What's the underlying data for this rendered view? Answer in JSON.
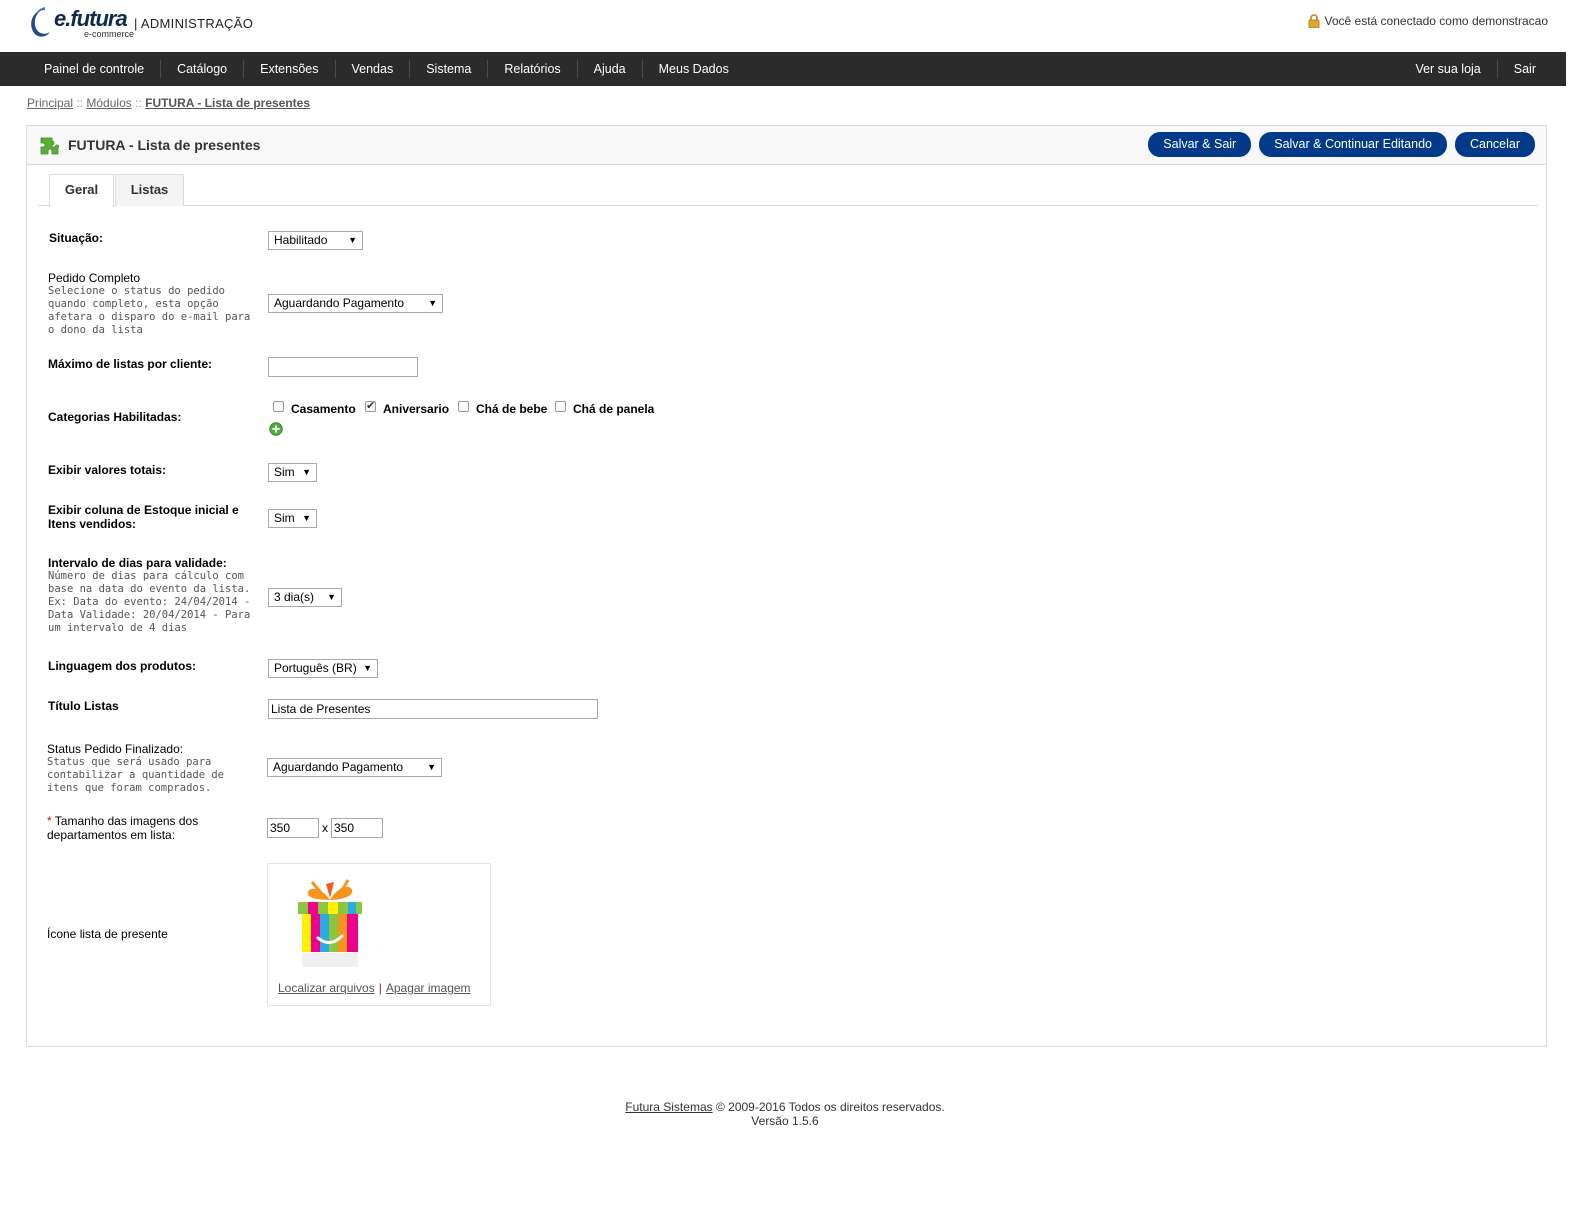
{
  "header": {
    "logo_main": "e.futura",
    "logo_sub": "e-commerce",
    "admin_label": "| ADMINISTRAÇÃO",
    "logged_text": "Você está conectado como demonstracao"
  },
  "menu": {
    "left": [
      "Painel de controle",
      "Catálogo",
      "Extensões",
      "Vendas",
      "Sistema",
      "Relatórios",
      "Ajuda",
      "Meus Dados"
    ],
    "right": [
      "Ver sua loja",
      "Sair"
    ]
  },
  "breadcrumb": {
    "items": [
      "Principal",
      "Módulos",
      "FUTURA - Lista de presentes"
    ],
    "separator": "::"
  },
  "box": {
    "title": "FUTURA - Lista de presentes",
    "buttons": {
      "save_exit": "Salvar & Sair",
      "save_continue": "Salvar & Continuar Editando",
      "cancel": "Cancelar"
    }
  },
  "tabs": [
    "Geral",
    "Listas"
  ],
  "form": {
    "situacao": {
      "label": "Situação:",
      "value": "Habilitado"
    },
    "pedido_completo": {
      "label": "Pedido Completo",
      "help": "Selecione o status do pedido quando completo, esta opção afetara o disparo do e-mail para o dono da lista",
      "value": "Aguardando Pagamento"
    },
    "max_listas": {
      "label": "Máximo de listas por cliente:",
      "value": ""
    },
    "categorias": {
      "label": "Categorias Habilitadas:",
      "options": [
        {
          "label": "Casamento",
          "checked": false
        },
        {
          "label": "Aniversario",
          "checked": true
        },
        {
          "label": "Chá de bebe",
          "checked": false
        },
        {
          "label": "Chá de panela",
          "checked": false
        }
      ]
    },
    "exibir_totais": {
      "label": "Exibir valores totais:",
      "value": "Sim"
    },
    "exibir_estoque": {
      "label": "Exibir coluna de Estoque inicial e Itens vendidos:",
      "value": "Sim"
    },
    "intervalo": {
      "label": "Intervalo de dias para validade:",
      "help": "Número de dias para cálculo com base na data do evento da lista. Ex: Data do evento: 24/04/2014 - Data Validade: 20/04/2014 - Para um intervalo de 4 dias",
      "value": "3 dia(s)"
    },
    "linguagem": {
      "label": "Linguagem dos produtos:",
      "value": "Português (BR)"
    },
    "titulo": {
      "label": "Título Listas",
      "value": "Lista de Presentes"
    },
    "status_finalizado": {
      "label": "Status Pedido Finalizado:",
      "help": "Status que será usado para contabilizar a quantidade de itens que foram comprados.",
      "value": "Aguardando Pagamento"
    },
    "tamanho": {
      "required_mark": "*",
      "label": "Tamanho das imagens dos departamentos em lista:",
      "width": "350",
      "separator": "x",
      "height": "350"
    },
    "icone": {
      "label": "Ícone lista de presente",
      "browse_link": "Localizar arquivos",
      "link_separator": "|",
      "delete_link": "Apagar imagem"
    }
  },
  "footer": {
    "company": "Futura Sistemas",
    "rights": "© 2009-2016 Todos os direitos reservados.",
    "version": "Versão 1.5.6"
  },
  "colors": {
    "menu_bg": "#2b2b2b",
    "button_bg": "#003a88",
    "plugin_green": "#5cae3b"
  }
}
